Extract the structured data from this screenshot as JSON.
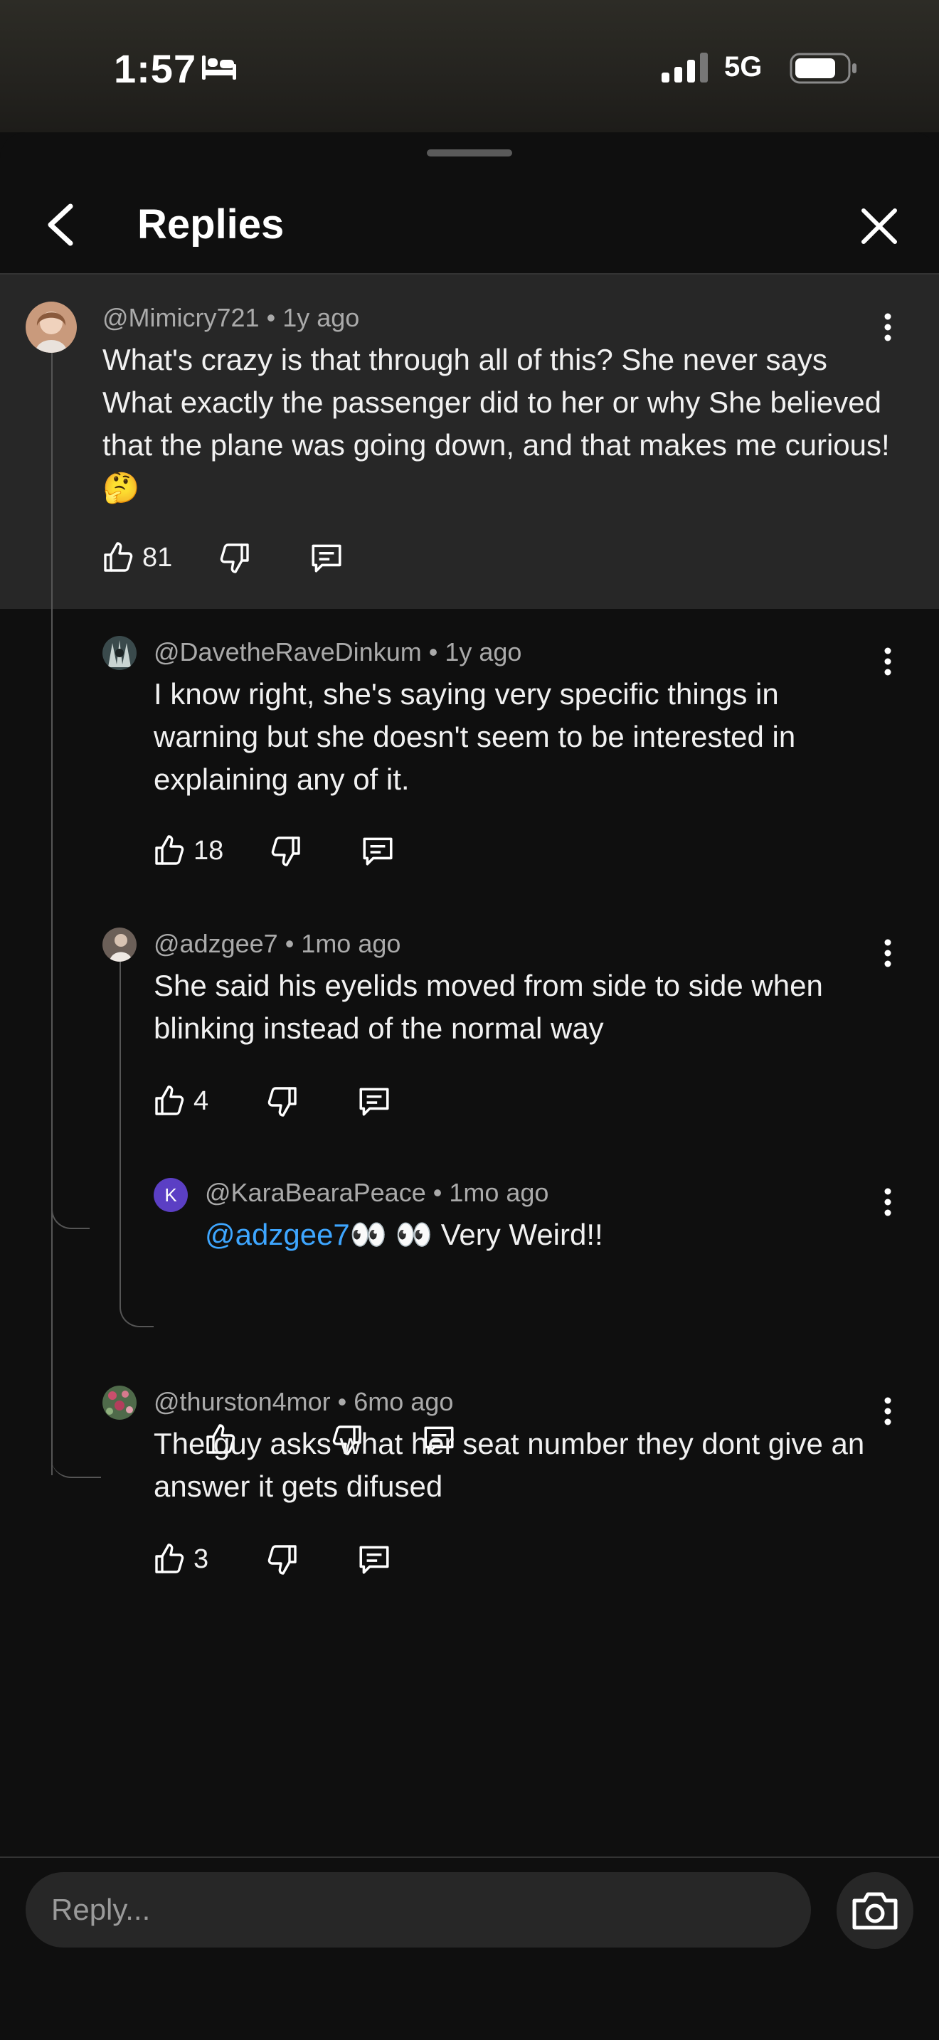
{
  "status_bar": {
    "time": "1:57",
    "network": "5G",
    "icons": [
      "bed-icon",
      "signal-icon",
      "battery-icon"
    ]
  },
  "sheet": {
    "title": "Replies",
    "icons": [
      "back-chevron-icon",
      "close-icon"
    ]
  },
  "comments": [
    {
      "author": "@Mimicry721",
      "time": "1y ago",
      "text": "What's crazy is that through all of this? She never says What exactly the passenger did to her or why She believed that the plane was going down, and that makes me curious! 🤔",
      "likes": "81"
    },
    {
      "author": "@DavetheRaveDinkum",
      "time": "1y ago",
      "text": "I know right, she's saying very specific things in warning but she doesn't seem to be interested in explaining any of it.",
      "likes": "18"
    },
    {
      "author": "@adzgee7",
      "time": "1mo ago",
      "text": "She said his eyelids moved from side to side when blinking instead of the normal way",
      "likes": "4"
    },
    {
      "author": "@KaraBearaPeace",
      "time": "1mo ago",
      "avatar_letter": "K",
      "mention": "@adzgee7",
      "text": "👀 👀 Very Weird!!",
      "likes": ""
    },
    {
      "author": "@thurston4mor",
      "time": "6mo ago",
      "text": "The guy asks what her seat number they dont give an answer it gets difused",
      "likes": "3"
    }
  ],
  "footer": {
    "reply_placeholder": "Reply...",
    "icons": [
      "camera-icon"
    ]
  },
  "colors": {
    "background": "#0f0f0f",
    "highlight": "#272727",
    "mention": "#3ea6ff",
    "muted_text": "#aaaaaa",
    "avatar_purple": "#5b3fc4"
  }
}
